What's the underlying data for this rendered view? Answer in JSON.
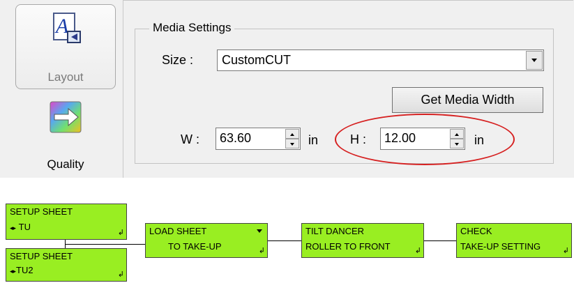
{
  "sidebar": {
    "items": [
      {
        "label": "Layout",
        "icon": "layout-icon",
        "selected": true
      },
      {
        "label": "Quality",
        "icon": "quality-icon",
        "selected": false
      }
    ]
  },
  "media_settings": {
    "title": "Media Settings",
    "size_label": "Size :",
    "size_value": "CustomCUT",
    "get_width_button": "Get Media Width",
    "width_label": "W :",
    "width_value": "63.60",
    "width_unit": "in",
    "height_label": "H :",
    "height_value": "12.00",
    "height_unit": "in",
    "highlight_color": "#d62020"
  },
  "flowchart": {
    "node_color": "#99ee22",
    "nodes": [
      {
        "line1": "SETUP SHEET",
        "line2": "TU",
        "has_arrows": true
      },
      {
        "line1": "SETUP SHEET",
        "line2": "TU2",
        "has_arrows": true
      },
      {
        "line1": "LOAD SHEET",
        "line2": "TO TAKE-UP",
        "has_dropdown": true
      },
      {
        "line1": "TILT DANCER",
        "line2": "ROLLER TO FRONT"
      },
      {
        "line1": "CHECK",
        "line2": "TAKE-UP SETTING"
      }
    ],
    "arrows_glyph": "◂▸",
    "enter_glyph": "↲"
  }
}
